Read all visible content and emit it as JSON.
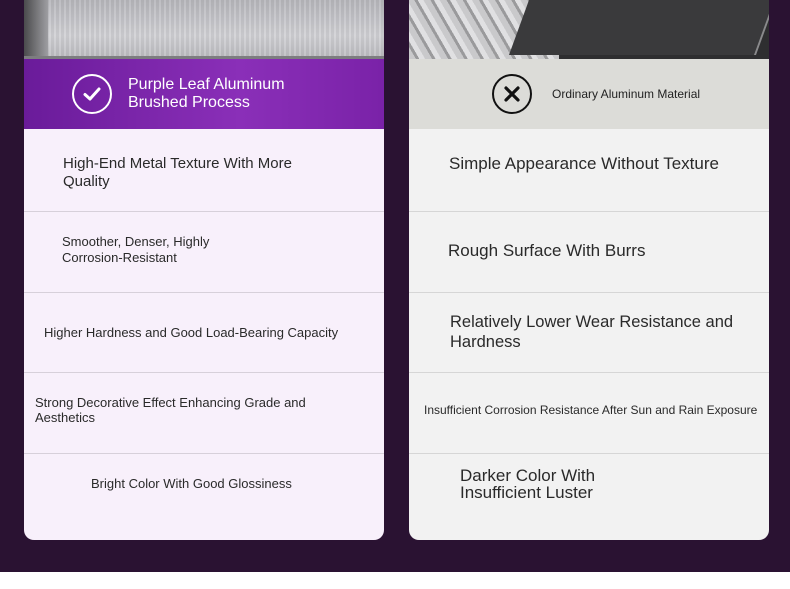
{
  "left_card": {
    "title": "Purple Leaf Aluminum Brushed Process",
    "icon": "check-icon",
    "features": [
      "High-End Metal Texture With More Quality",
      "Smoother, Denser, Highly Corrosion-Resistant",
      "Higher Hardness and Good Load-Bearing Capacity",
      "Strong Decorative Effect Enhancing Grade and Aesthetics",
      "Bright Color With Good Glossiness"
    ]
  },
  "right_card": {
    "title": "Ordinary Aluminum Material",
    "icon": "x-icon",
    "features": [
      "Simple Appearance Without Texture",
      "Rough Surface With Burrs",
      "Relatively Lower Wear Resistance and Hardness",
      "Insufficient Corrosion Resistance After Sun and Rain Exposure",
      "Darker Color With Insufficient Luster"
    ]
  },
  "colors": {
    "background": "#2a1232",
    "accent_purple": "#7a22a8",
    "left_card_bg": "#f8f0fb",
    "right_card_bg": "#f2f2f2"
  }
}
